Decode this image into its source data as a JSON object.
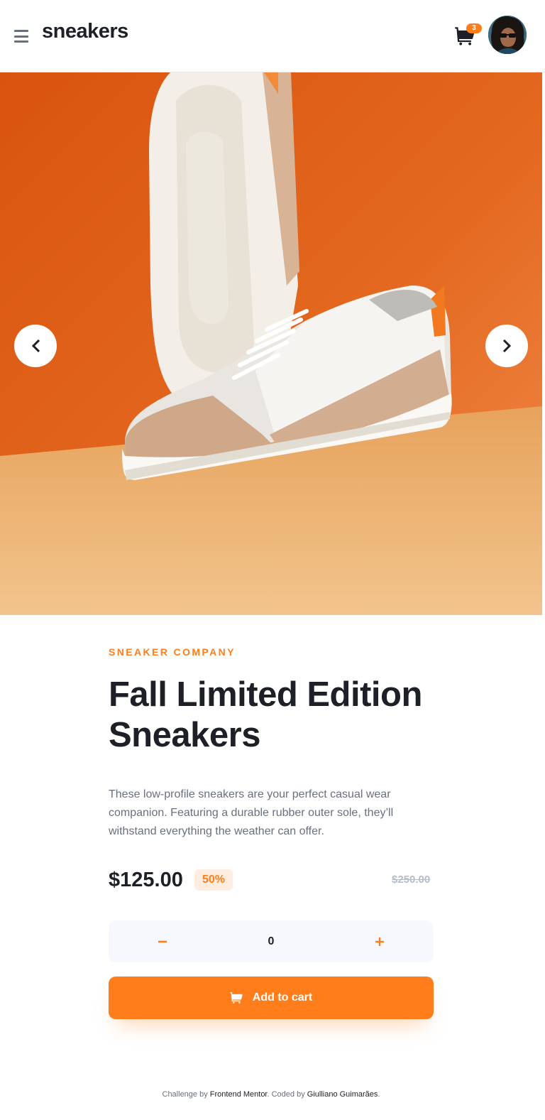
{
  "header": {
    "logo": "sneakers",
    "cart_count": "3"
  },
  "product": {
    "company": "SNEAKER COMPANY",
    "title": "Fall Limited Edition Sneakers",
    "description": "These low-profile sneakers are your perfect casual wear companion. Featuring a durable rubber outer sole, they’ll withstand everything the weather can offer.",
    "price": "$125.00",
    "discount": "50%",
    "original_price": "$250.00",
    "quantity": "0",
    "add_to_cart": "Add to cart"
  },
  "footer": {
    "prefix": "Challenge by ",
    "challenge_link": "Frontend Mentor",
    "middle": ". Coded by ",
    "author_link": "Giulliano Guimarães",
    "suffix": "."
  },
  "colors": {
    "accent": "#ff7e1b",
    "accent_pale": "#ffede0",
    "text_dark": "#1d2026",
    "text_gray": "#69707d",
    "text_light": "#b6bcc8",
    "qty_bg": "#f6f8fd"
  },
  "icons": [
    "menu-icon",
    "cart-icon",
    "avatar",
    "chevron-left-icon",
    "chevron-right-icon",
    "minus-icon",
    "plus-icon"
  ]
}
